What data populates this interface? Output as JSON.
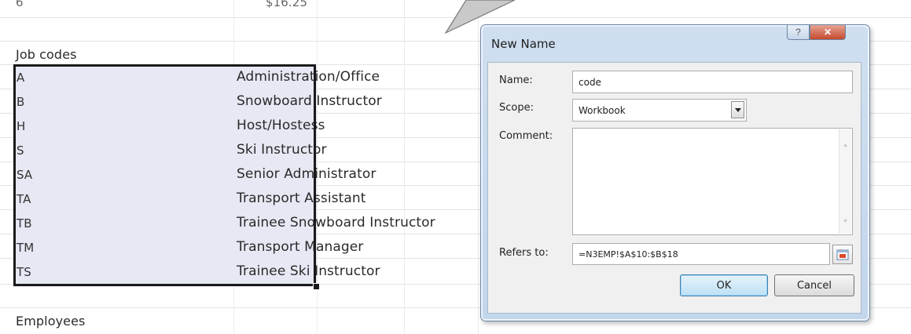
{
  "sheet": {
    "top_row_col_a": "6",
    "top_row_col_b": "$16.25",
    "section_job_codes": "Job codes",
    "section_employees": "Employees",
    "job_codes": [
      {
        "code": "A",
        "title": "Administration/Office"
      },
      {
        "code": "B",
        "title": "Snowboard Instructor"
      },
      {
        "code": "H",
        "title": "Host/Hostess"
      },
      {
        "code": "S",
        "title": "Ski Instructor"
      },
      {
        "code": "SA",
        "title": "Senior Administrator"
      },
      {
        "code": "TA",
        "title": "Transport Assistant"
      },
      {
        "code": "TB",
        "title": "Trainee Snowboard Instructor"
      },
      {
        "code": "TM",
        "title": "Transport Manager"
      },
      {
        "code": "TS",
        "title": "Trainee Ski Instructor"
      }
    ]
  },
  "dialog": {
    "title": "New Name",
    "help_label": "?",
    "close_label": "✕",
    "name_label": "Name:",
    "name_value": "code",
    "scope_label": "Scope:",
    "scope_value": "Workbook",
    "comment_label": "Comment:",
    "comment_value": "",
    "refers_to_label": "Refers to:",
    "refers_to_value": "=N3EMP!$A$10:$B$18",
    "ok_label": "OK",
    "cancel_label": "Cancel"
  },
  "icons": {
    "combo": "chevron-down-icon",
    "collapse": "range-collapse-icon",
    "pointer": "callout-pointer"
  },
  "colors": {
    "selection_fill": "#e6e8f3",
    "selection_border": "#1a1a1a",
    "dialog_frame": "#c2d6ec",
    "close_button": "#c54b2f",
    "ok_button": "#bde0f5"
  }
}
